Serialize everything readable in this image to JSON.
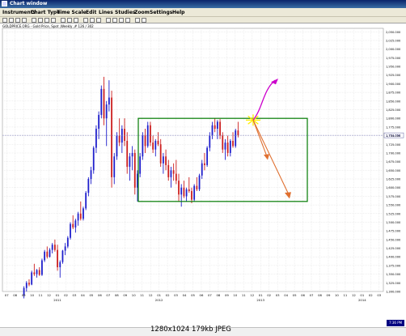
{
  "window": {
    "title": "Chart window"
  },
  "menu": [
    "Instruments",
    "Chart Type",
    "Time Scale",
    "Edit",
    "Lines",
    "Studies",
    "Zoom",
    "Settings",
    "Help"
  ],
  "chart": {
    "title": "GOLDPRICE.ORG - Gold Price, Spot ,Weekly ,# 126 / 302",
    "price_label": "1,751.056",
    "clock": "7:36 PM"
  },
  "caption": {
    "dimensions": "1280x1024",
    "size": "179kb",
    "format": "JPEG"
  },
  "colors": {
    "up_candle": "#1f1fcc",
    "down_candle": "#cc1f1f",
    "rectangle": "#007a00",
    "arrow_up": "#cc00cc",
    "arrow_down": "#e07030",
    "burst": "#ffee00",
    "grid": "#d8d8d8",
    "price_line": "#8080c0"
  },
  "chart_data": {
    "type": "candlestick",
    "y_ticks": [
      "2,050.000",
      "2,025.000",
      "2,000.000",
      "1,975.000",
      "1,950.000",
      "1,925.000",
      "1,900.000",
      "1,875.000",
      "1,850.000",
      "1,825.000",
      "1,800.000",
      "1,775.000",
      "1,750.000",
      "1,725.000",
      "1,700.000",
      "1,675.000",
      "1,650.000",
      "1,625.000",
      "1,600.000",
      "1,575.000",
      "1,550.000",
      "1,525.000",
      "1,500.000",
      "1,475.000",
      "1,450.000",
      "1,425.000",
      "1,400.000",
      "1,375.000",
      "1,350.000",
      "1,325.000",
      "1,300.000"
    ],
    "x_months": [
      "07",
      "08",
      "09",
      "10",
      "11",
      "12",
      "01",
      "02",
      "03",
      "04",
      "05",
      "06",
      "07",
      "08",
      "09",
      "10",
      "11",
      "12",
      "01",
      "02",
      "03",
      "04",
      "05",
      "06",
      "07",
      "08",
      "09",
      "10",
      "11",
      "12",
      "01",
      "02",
      "03",
      "04",
      "05",
      "06",
      "07",
      "08",
      "09",
      "10",
      "11",
      "12",
      "01",
      "02",
      "03"
    ],
    "x_years": [
      "2011",
      "2012",
      "2013",
      "2014"
    ],
    "ylim": [
      1300,
      2060
    ],
    "candles": [
      [
        1290,
        1315,
        1280,
        1310
      ],
      [
        1310,
        1330,
        1300,
        1325
      ],
      [
        1325,
        1335,
        1315,
        1320
      ],
      [
        1320,
        1360,
        1318,
        1355
      ],
      [
        1355,
        1380,
        1345,
        1350
      ],
      [
        1350,
        1365,
        1340,
        1362
      ],
      [
        1362,
        1370,
        1345,
        1348
      ],
      [
        1348,
        1395,
        1345,
        1390
      ],
      [
        1390,
        1420,
        1385,
        1415
      ],
      [
        1415,
        1430,
        1395,
        1400
      ],
      [
        1400,
        1425,
        1398,
        1420
      ],
      [
        1420,
        1440,
        1410,
        1435
      ],
      [
        1435,
        1450,
        1415,
        1420
      ],
      [
        1420,
        1435,
        1360,
        1370
      ],
      [
        1370,
        1390,
        1340,
        1385
      ],
      [
        1385,
        1420,
        1380,
        1418
      ],
      [
        1418,
        1440,
        1405,
        1430
      ],
      [
        1430,
        1460,
        1425,
        1455
      ],
      [
        1455,
        1500,
        1450,
        1495
      ],
      [
        1495,
        1520,
        1480,
        1485
      ],
      [
        1485,
        1510,
        1470,
        1505
      ],
      [
        1505,
        1530,
        1490,
        1525
      ],
      [
        1525,
        1560,
        1505,
        1510
      ],
      [
        1510,
        1545,
        1505,
        1540
      ],
      [
        1540,
        1590,
        1535,
        1585
      ],
      [
        1585,
        1630,
        1575,
        1625
      ],
      [
        1625,
        1660,
        1610,
        1650
      ],
      [
        1650,
        1720,
        1640,
        1715
      ],
      [
        1715,
        1780,
        1700,
        1770
      ],
      [
        1770,
        1820,
        1740,
        1810
      ],
      [
        1810,
        1895,
        1800,
        1885
      ],
      [
        1885,
        1920,
        1780,
        1800
      ],
      [
        1800,
        1850,
        1720,
        1840
      ],
      [
        1840,
        1910,
        1820,
        1860
      ],
      [
        1860,
        1880,
        1600,
        1630
      ],
      [
        1630,
        1700,
        1610,
        1690
      ],
      [
        1690,
        1760,
        1680,
        1750
      ],
      [
        1750,
        1800,
        1720,
        1730
      ],
      [
        1730,
        1780,
        1700,
        1770
      ],
      [
        1770,
        1800,
        1720,
        1735
      ],
      [
        1735,
        1760,
        1640,
        1660
      ],
      [
        1660,
        1700,
        1620,
        1690
      ],
      [
        1690,
        1720,
        1650,
        1700
      ],
      [
        1700,
        1710,
        1580,
        1600
      ],
      [
        1600,
        1650,
        1560,
        1640
      ],
      [
        1640,
        1700,
        1630,
        1690
      ],
      [
        1690,
        1760,
        1680,
        1750
      ],
      [
        1750,
        1770,
        1700,
        1720
      ],
      [
        1720,
        1790,
        1715,
        1780
      ],
      [
        1780,
        1790,
        1720,
        1730
      ],
      [
        1730,
        1750,
        1700,
        1710
      ],
      [
        1710,
        1740,
        1690,
        1735
      ],
      [
        1735,
        1760,
        1720,
        1725
      ],
      [
        1725,
        1740,
        1660,
        1670
      ],
      [
        1670,
        1700,
        1640,
        1690
      ],
      [
        1690,
        1710,
        1650,
        1665
      ],
      [
        1665,
        1680,
        1620,
        1630
      ],
      [
        1630,
        1660,
        1600,
        1650
      ],
      [
        1650,
        1670,
        1620,
        1640
      ],
      [
        1640,
        1680,
        1610,
        1620
      ],
      [
        1620,
        1640,
        1560,
        1580
      ],
      [
        1580,
        1610,
        1545,
        1600
      ],
      [
        1600,
        1620,
        1570,
        1575
      ],
      [
        1575,
        1600,
        1560,
        1595
      ],
      [
        1595,
        1630,
        1585,
        1590
      ],
      [
        1590,
        1600,
        1555,
        1565
      ],
      [
        1565,
        1610,
        1560,
        1605
      ],
      [
        1605,
        1630,
        1590,
        1595
      ],
      [
        1595,
        1640,
        1590,
        1635
      ],
      [
        1635,
        1680,
        1625,
        1670
      ],
      [
        1670,
        1700,
        1650,
        1665
      ],
      [
        1665,
        1720,
        1660,
        1715
      ],
      [
        1715,
        1760,
        1705,
        1750
      ],
      [
        1750,
        1790,
        1740,
        1780
      ],
      [
        1780,
        1800,
        1760,
        1770
      ],
      [
        1770,
        1795,
        1740,
        1790
      ],
      [
        1790,
        1798,
        1740,
        1750
      ],
      [
        1750,
        1760,
        1700,
        1710
      ],
      [
        1710,
        1740,
        1680,
        1730
      ],
      [
        1730,
        1750,
        1690,
        1700
      ],
      [
        1700,
        1740,
        1690,
        1735
      ],
      [
        1735,
        1760,
        1715,
        1720
      ],
      [
        1720,
        1770,
        1715,
        1765
      ],
      [
        1765,
        1790,
        1745,
        1751
      ]
    ]
  }
}
